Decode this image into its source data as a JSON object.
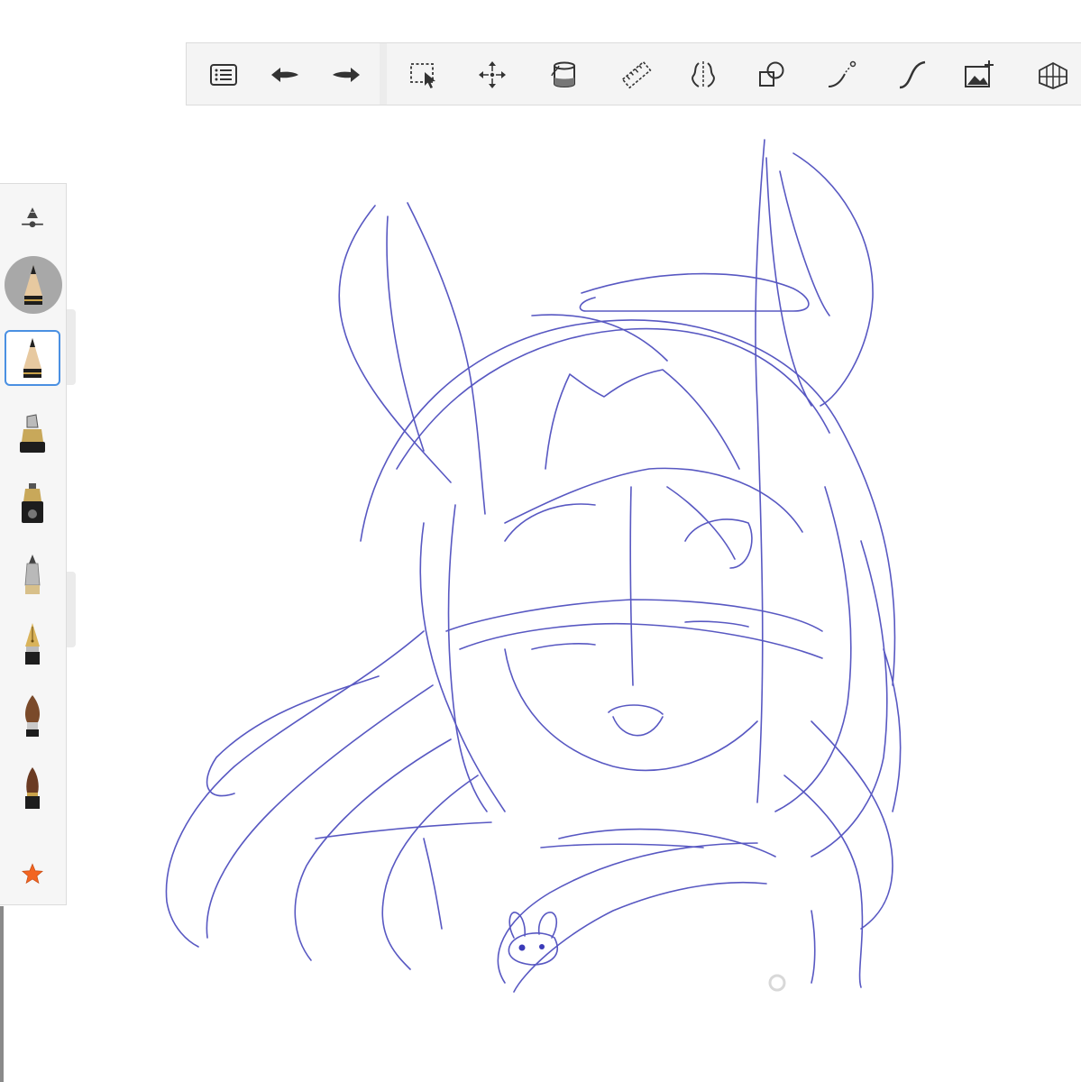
{
  "colors": {
    "stroke": "#3b3bb8",
    "toolbar_bg": "#f4f4f4",
    "palette_bg": "#f6f6f6",
    "selection": "#4a90e2",
    "favorite_star": "#f26522"
  },
  "toolbar": {
    "tools": [
      {
        "id": "menu",
        "icon": "list-menu-icon"
      },
      {
        "id": "undo",
        "icon": "undo-arrow-icon"
      },
      {
        "id": "redo",
        "icon": "redo-arrow-icon"
      },
      {
        "id": "selection",
        "icon": "selection-icon"
      },
      {
        "id": "transform",
        "icon": "move-arrows-icon"
      },
      {
        "id": "fill",
        "icon": "paint-bucket-icon"
      },
      {
        "id": "ruler",
        "icon": "ruler-icon"
      },
      {
        "id": "symmetry",
        "icon": "symmetry-icon"
      },
      {
        "id": "shapes",
        "icon": "shapes-icon"
      },
      {
        "id": "predictive-stroke",
        "icon": "predictive-stroke-icon"
      },
      {
        "id": "steady-stroke",
        "icon": "steady-stroke-icon"
      },
      {
        "id": "add-image",
        "icon": "add-image-icon"
      },
      {
        "id": "perspective",
        "icon": "perspective-grid-icon"
      }
    ]
  },
  "brush_palette": {
    "brushes": [
      {
        "id": "pencil",
        "icon": "pencil-brush-icon",
        "selected": true
      },
      {
        "id": "marker",
        "icon": "marker-brush-icon",
        "selected": false
      },
      {
        "id": "airbrush",
        "icon": "airbrush-icon",
        "selected": false
      },
      {
        "id": "ballpoint",
        "icon": "ballpoint-pen-icon",
        "selected": false
      },
      {
        "id": "fountain-pen",
        "icon": "fountain-pen-icon",
        "selected": false
      },
      {
        "id": "paint-brush",
        "icon": "paint-brush-icon",
        "selected": false
      },
      {
        "id": "ink-brush",
        "icon": "ink-brush-icon",
        "selected": false
      },
      {
        "id": "favorites",
        "icon": "star-icon",
        "selected": false
      }
    ]
  }
}
